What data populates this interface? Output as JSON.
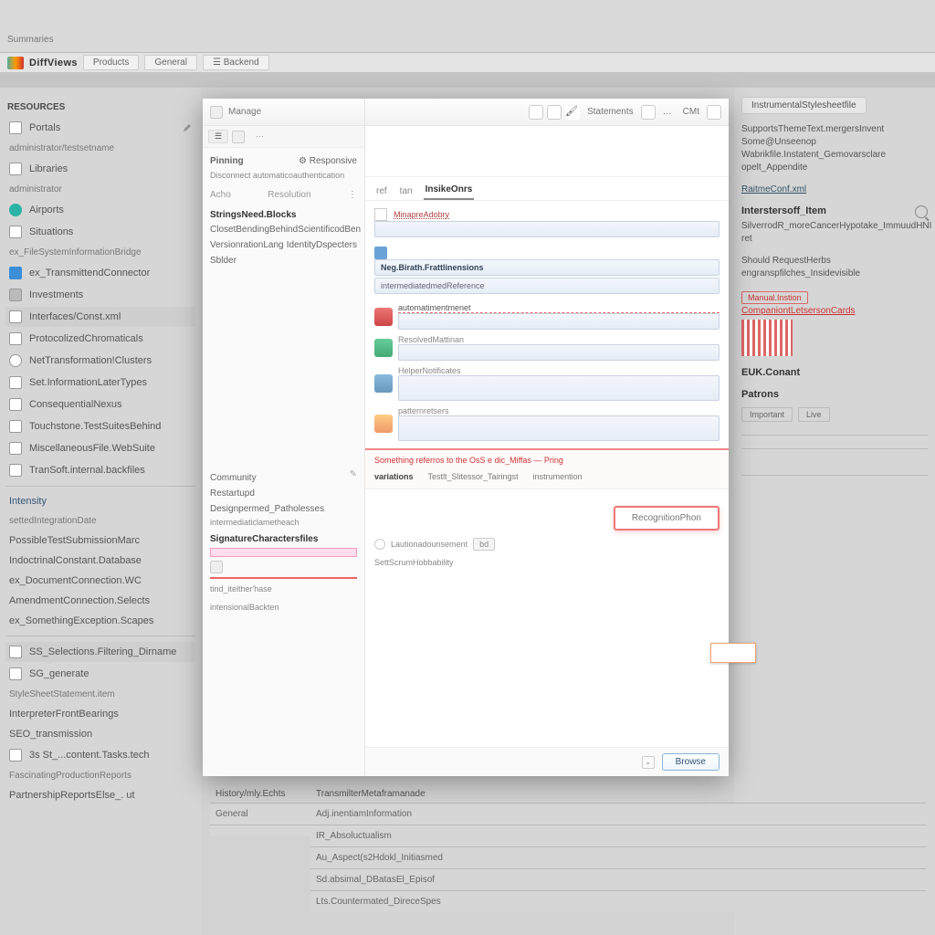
{
  "app": {
    "breadcrumbs": "Summaries",
    "brand": "DiffViews",
    "tabs": [
      "Products",
      "General",
      "Backend"
    ]
  },
  "sidebar": {
    "title": "Resources",
    "items": [
      {
        "label": "Portals",
        "icon": "box"
      },
      {
        "sub": "administrator/testsetname"
      },
      {
        "label": "Libraries",
        "icon": "chart"
      },
      {
        "sub": "administrator"
      },
      {
        "label": "Airports",
        "icon": "teal-round"
      },
      {
        "label": "Situations",
        "icon": "doc"
      },
      {
        "sub": "ex_FileSystemInformationBridge"
      },
      {
        "label": "ex_TransmittendConnector",
        "icon": "bluesq"
      },
      {
        "label": "Investments",
        "icon": "gray"
      },
      {
        "label": "Interfaces/Const.xml",
        "hl": true
      },
      {
        "label": "ProtocolizedChromaticals"
      },
      {
        "label": "NetTransformation!Clusters"
      },
      {
        "label": "Set.InformationLaterTypes"
      },
      {
        "label": "ConsequentialNexus"
      },
      {
        "label": "Touchstone.TestSuitesBehind"
      },
      {
        "label": "MiscellaneousFile.WebSuite"
      },
      {
        "label": "TranSoft.internal.backfiles"
      },
      {
        "label": "Intensity",
        "link": true
      },
      {
        "sub": "settedIntegrationDate"
      },
      {
        "label": "PossibleTestSubmissionMarc"
      },
      {
        "label": "IndoctrinalConstant.Database"
      },
      {
        "label": "ex_DocumentConnection.WC"
      },
      {
        "label": "AmendmentConnection.Selects"
      },
      {
        "label": "ex_SomethingException.Scapes"
      },
      {
        "label": "SS_Selections.Filtering_Dirname",
        "hl": true
      },
      {
        "label": "SG_generate"
      },
      {
        "sub": "StyleSheetStatement.item"
      },
      {
        "label": "InterpreterFrontBearings"
      },
      {
        "label": "SEO_transmission"
      },
      {
        "label": "3s St_...content.Tasks.tech"
      },
      {
        "sub": "FascinatingProductionReports"
      },
      {
        "label": "PartnershipReportsElse_. ut"
      }
    ]
  },
  "rightpane": {
    "chip": "InstrumentalStylesheetfile",
    "para1": "SupportsThemeText.mergersInvent Some@Unseenop Wabrikfile.Instatent_Gemovarsclare opelt_Appendite",
    "link1": "RaitmeConf.xml",
    "h1": "Interstersoff_Item",
    "para2": "SilverrodR_moreCancerHypotake_ImmuudHNI  ret",
    "para3": "Should RequestHerbs engranspfilches_Insidevisible",
    "redlink1": "Manual.Instion",
    "redlink2": "CompaniontLetsersonCards",
    "h2": "EUK.Conant",
    "h3": "Patrons",
    "tags": [
      "Important",
      "Live"
    ]
  },
  "modal": {
    "title": "Manage",
    "leftTab": "Pinning",
    "leftSub": "Responsive",
    "leftDesc": "Disconnect automaticoauthentication",
    "leftCols": [
      "Acho",
      "Resolution"
    ],
    "leftSectionTitle": "StringsNeed.Blocks",
    "leftRows": [
      [
        "ClosetBendingBehind",
        "ScientificodBen"
      ],
      [
        "VersionrationLang",
        "IdentityDspecters"
      ],
      [
        "Sblder",
        ""
      ]
    ],
    "leftBottom": [
      "Community",
      "Restartupd",
      "Designpermed_Patholesses",
      "intermediaticlametheach",
      "SignatureCharactersfiles",
      "tind_itelther'hase",
      "intensionalBackten"
    ],
    "toolbar": [
      "Statements",
      "CMt"
    ],
    "tabs": [
      "ref",
      "tan",
      "InsikeOnrs"
    ],
    "fields": [
      {
        "label": "MinapreAdobry",
        "value": ""
      },
      {
        "label": "",
        "value": "Neg.Birath.Frattlinensions",
        "hint": "intermediatedmedReference"
      }
    ],
    "items": [
      {
        "icon": "r",
        "title": "automatimentmenet"
      },
      {
        "icon": "g",
        "title": "ResolvedMattinan"
      },
      {
        "icon": "b",
        "title": "HelperNotificates"
      },
      {
        "icon": "y",
        "title": "patternretsers"
      }
    ],
    "alert": {
      "warning": "Something referros to the OsS e dic_Miffas — Pring",
      "tabs": [
        "variations",
        "Testlt_Slitessor_Tairingst",
        "instrumention"
      ]
    },
    "cta": "RecognitionPhon",
    "footRow": {
      "label": "Lautionadounsement",
      "mini": "bd"
    },
    "footRow2": "SettScrumHobbability",
    "footer": {
      "primary": "Browse"
    }
  },
  "table": {
    "head": "TransmilterMetaframanade",
    "left": [
      "History/mly.Echts",
      "General",
      ""
    ],
    "rows": [
      "Adj.inentiamInformation",
      "IR_Absoluctualism",
      "Au_Aspect(s2Hdokl_Initiasmed",
      "Sd.absimal_DBatasEl_Episof",
      "Lts.Countermated_DireceSpes"
    ]
  }
}
